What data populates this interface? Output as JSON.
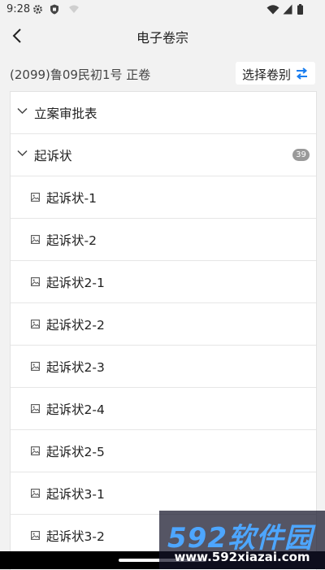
{
  "status": {
    "time": "9:28",
    "icons": [
      "gear-icon",
      "shield-icon",
      "wifi-off-icon",
      "wifi-icon",
      "signal-icon",
      "battery-icon"
    ]
  },
  "header": {
    "title": "电子卷宗",
    "back_icon": "chevron-left-icon"
  },
  "case": {
    "number": "(2099)鲁09民初1号 正卷",
    "select_label": "选择卷别",
    "select_icon": "swap-icon"
  },
  "groups": [
    {
      "title": "立案审批表",
      "expanded": false
    },
    {
      "title": "起诉状",
      "expanded": true,
      "count": "39"
    }
  ],
  "items": [
    "起诉状-1",
    "起诉状-2",
    "起诉状2-1",
    "起诉状2-2",
    "起诉状2-3",
    "起诉状2-4",
    "起诉状2-5",
    "起诉状3-1",
    "起诉状3-2"
  ],
  "watermark": {
    "brand": "592软件园",
    "url": "www.592xiazai.com"
  },
  "colors": {
    "accent": "#1a7ef0",
    "badge": "#9a9a9a",
    "background": "#f2f2f2"
  }
}
